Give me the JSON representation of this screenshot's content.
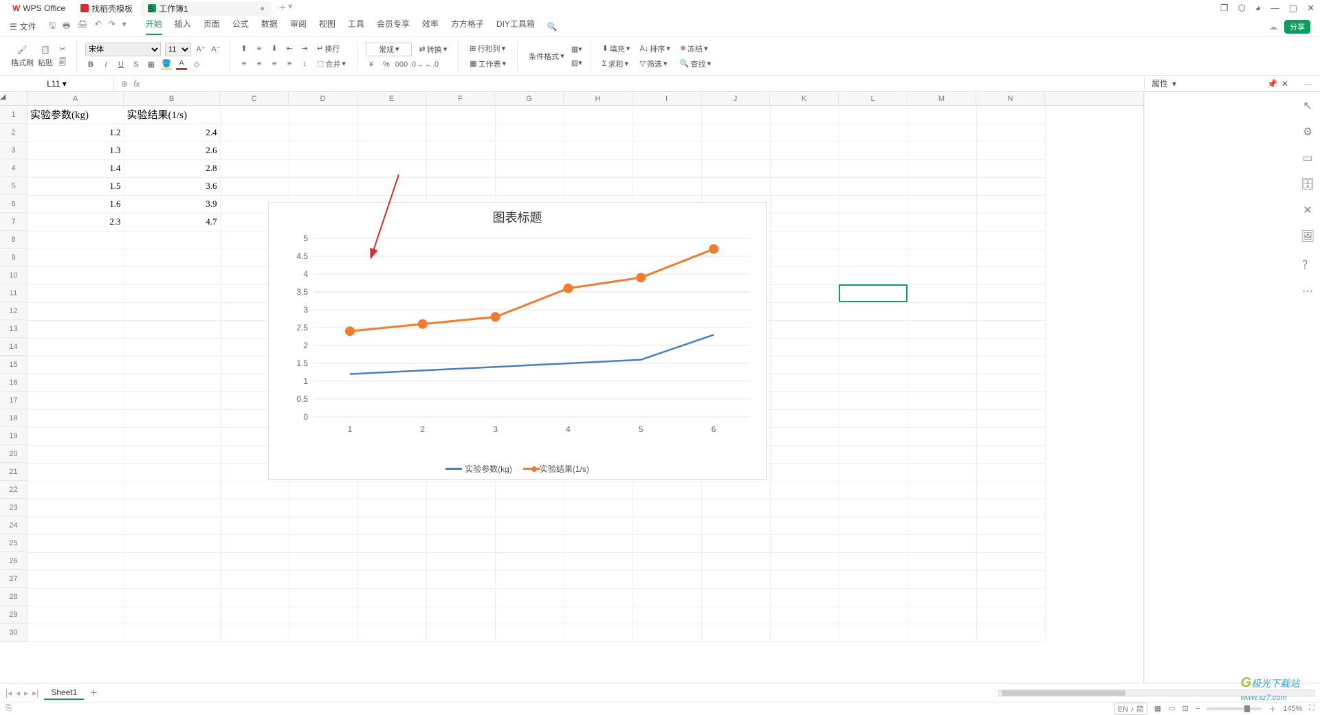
{
  "titlebar": {
    "wps_label": "WPS Office",
    "template_label": "找稻壳模板",
    "workbook_label": "工作簿1",
    "workbook_dirty": "●"
  },
  "menubar": {
    "file": "文件",
    "tabs": [
      "开始",
      "插入",
      "页面",
      "公式",
      "数据",
      "审阅",
      "视图",
      "工具",
      "会员专享",
      "效率",
      "方方格子",
      "DIY工具箱"
    ],
    "active_index": 0,
    "share": "分享"
  },
  "ribbon": {
    "format_brush": "格式刷",
    "paste": "粘贴",
    "font_name": "宋体",
    "font_size": "11",
    "wrap": "换行",
    "merge": "合并",
    "general": "常规",
    "convert": "转换",
    "condfmt": "条件格式",
    "rowcol": "行和列",
    "worksheet": "工作表",
    "fill": "填充",
    "sort": "排序",
    "freeze": "冻结",
    "sum": "求和",
    "filter": "筛选",
    "find": "查找"
  },
  "cellref": {
    "name": "L11",
    "fx_label": "fx"
  },
  "sidepanel": {
    "title": "属性"
  },
  "columns": [
    "A",
    "B",
    "C",
    "D",
    "E",
    "F",
    "G",
    "H",
    "I",
    "J",
    "K",
    "L",
    "M",
    "N"
  ],
  "row_count": 30,
  "table": {
    "headers": [
      "实验参数(kg)",
      "实验结果(1/s)"
    ],
    "rows": [
      [
        "1.2",
        "2.4"
      ],
      [
        "1.3",
        "2.6"
      ],
      [
        "1.4",
        "2.8"
      ],
      [
        "1.5",
        "3.6"
      ],
      [
        "1.6",
        "3.9"
      ],
      [
        "2.3",
        "4.7"
      ]
    ]
  },
  "selection": {
    "col_index": 11,
    "row_index": 10
  },
  "chart_data": {
    "type": "line",
    "title": "图表标题",
    "categories": [
      "1",
      "2",
      "3",
      "4",
      "5",
      "6"
    ],
    "series": [
      {
        "name": "实验参数(kg)",
        "values": [
          1.2,
          1.3,
          1.4,
          1.5,
          1.6,
          2.3
        ],
        "color": "#4a7ebb",
        "marker": false
      },
      {
        "name": "实验结果(1/s)",
        "values": [
          2.4,
          2.6,
          2.8,
          3.6,
          3.9,
          4.7
        ],
        "color": "#ed7d31",
        "marker": true
      }
    ],
    "ylim": [
      0,
      5
    ],
    "ystep": 0.5,
    "xlabel": "",
    "ylabel": ""
  },
  "sheetbar": {
    "sheet": "Sheet1"
  },
  "statusbar": {
    "zoom": "145%",
    "lang": "EN ♪ 简"
  },
  "watermark": {
    "text1": "极光下载站",
    "text2": "www.xz7.com"
  }
}
